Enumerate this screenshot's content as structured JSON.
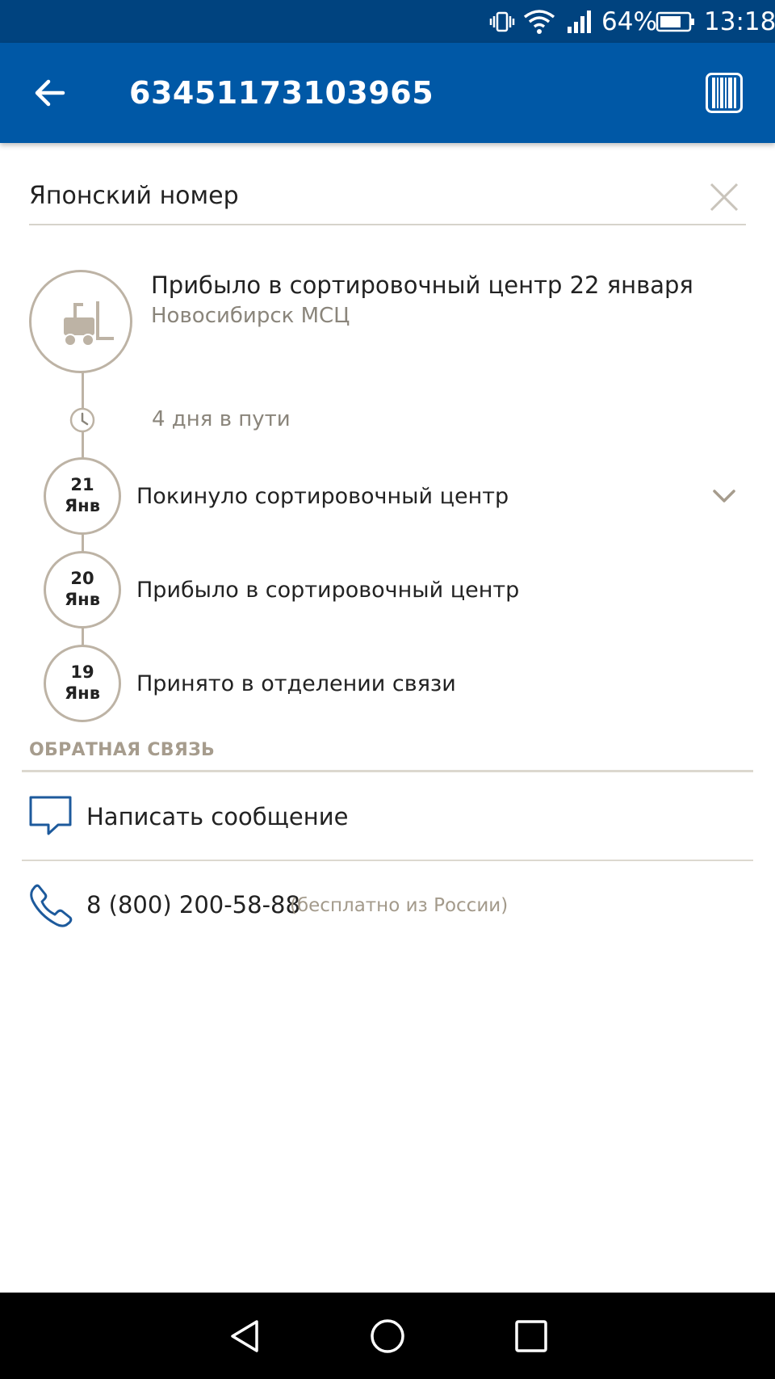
{
  "status_bar": {
    "battery_percent": "64%",
    "time": "13:18",
    "icons": [
      "vibrate-icon",
      "wifi-icon",
      "signal-icon",
      "battery-icon"
    ]
  },
  "app_bar": {
    "title": "63451173103965",
    "icons": [
      "back-arrow-icon",
      "barcode-icon"
    ]
  },
  "name_field": {
    "value": "Японский номер",
    "icon": "close-icon"
  },
  "latest_event": {
    "title": "Прибыло в сортировочный центр 22 января",
    "location": "Новосибирск МСЦ",
    "icon": "forklift-icon"
  },
  "transit": {
    "text": "4 дня в пути",
    "icon": "clock-icon"
  },
  "events": [
    {
      "day": "21",
      "month": "Янв",
      "label": "Покинуло сортировочный центр"
    },
    {
      "day": "20",
      "month": "Янв",
      "label": "Прибыло в сортировочный центр"
    },
    {
      "day": "19",
      "month": "Янв",
      "label": "Принято в отделении связи"
    }
  ],
  "feedback": {
    "section_title": "ОБРАТНАЯ СВЯЗЬ",
    "message_label": "Написать сообщение",
    "phone_number": "8 (800) 200-58-88",
    "phone_note": "(бесплатно из России)"
  },
  "nav_bar": {
    "icons": [
      "nav-back-icon",
      "nav-home-icon",
      "nav-recents-icon"
    ]
  },
  "colors": {
    "status_bar": "#00437f",
    "app_bar": "#0058a6",
    "timeline": "#bdb3a5",
    "accent_blue": "#1d5a9c"
  }
}
